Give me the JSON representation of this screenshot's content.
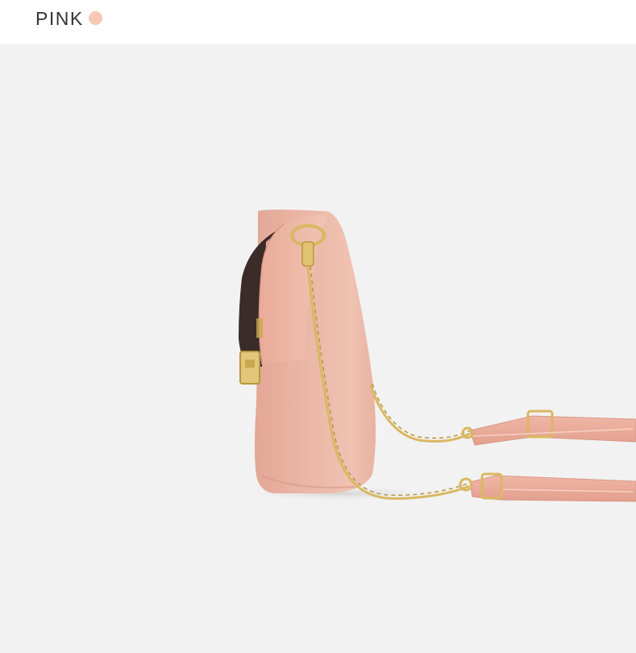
{
  "color_option": {
    "label": "PINK",
    "swatch_color": "#f7c8b4"
  },
  "product_image": {
    "icon": "shoulder-bag-side-view",
    "bag_color": "#e8ad9a",
    "hardware_color": "#d9b861",
    "background_color": "#f2f2f2"
  }
}
